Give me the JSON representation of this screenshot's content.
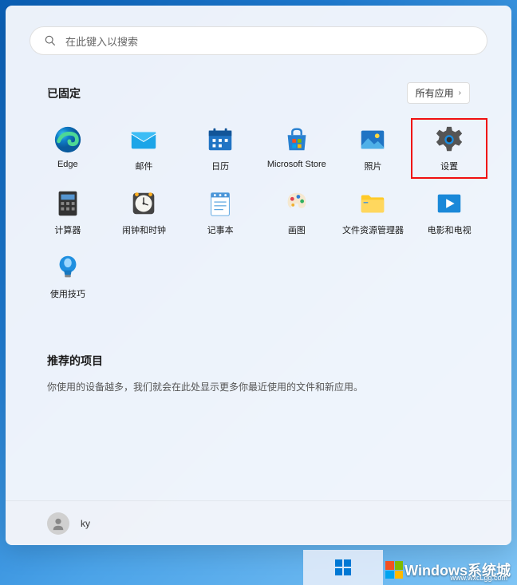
{
  "search": {
    "placeholder": "在此键入以搜索"
  },
  "pinned": {
    "title": "已固定",
    "all_apps_label": "所有应用",
    "apps": [
      {
        "name": "Edge",
        "icon": "edge"
      },
      {
        "name": "邮件",
        "icon": "mail"
      },
      {
        "name": "日历",
        "icon": "calendar"
      },
      {
        "name": "Microsoft Store",
        "icon": "store"
      },
      {
        "name": "照片",
        "icon": "photos"
      },
      {
        "name": "设置",
        "icon": "settings",
        "highlighted": true
      },
      {
        "name": "计算器",
        "icon": "calculator"
      },
      {
        "name": "闹钟和时钟",
        "icon": "clock"
      },
      {
        "name": "记事本",
        "icon": "notepad"
      },
      {
        "name": "画图",
        "icon": "paint"
      },
      {
        "name": "文件资源管理器",
        "icon": "explorer"
      },
      {
        "name": "电影和电视",
        "icon": "movies"
      },
      {
        "name": "使用技巧",
        "icon": "tips"
      }
    ]
  },
  "recommended": {
    "title": "推荐的项目",
    "description": "你使用的设备越多，我们就会在此处显示更多你最近使用的文件和新应用。"
  },
  "user": {
    "name": "ky"
  },
  "watermark": {
    "main": "Windows系统城",
    "sub": "www.wxcLgg.com"
  }
}
